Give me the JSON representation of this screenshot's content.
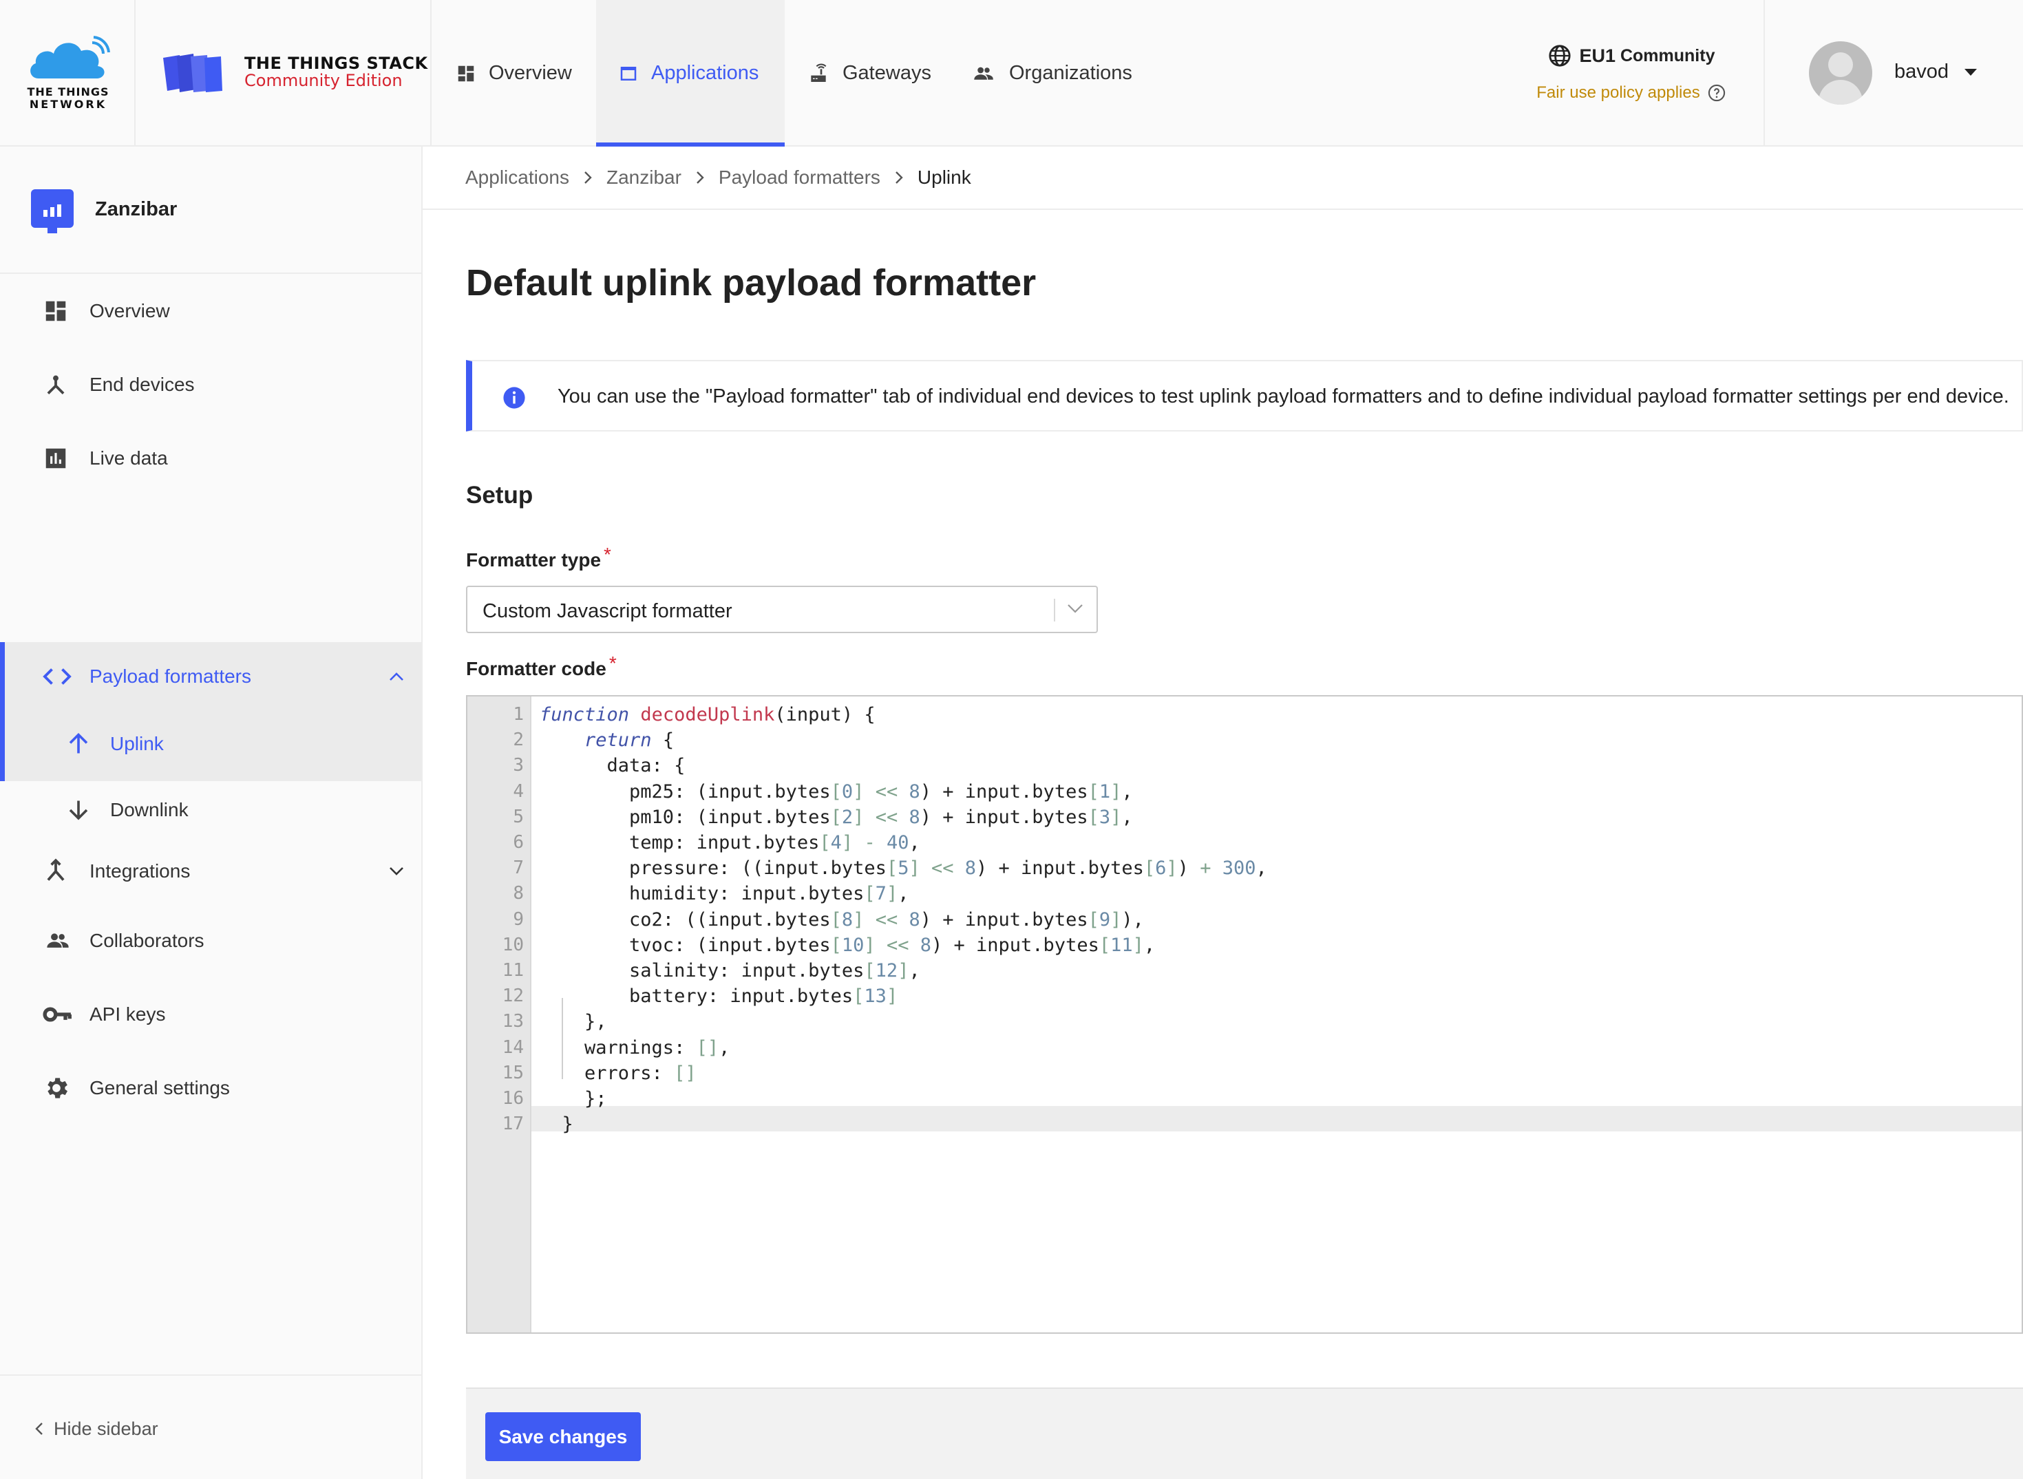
{
  "header": {
    "ttn_logo_line1": "THE THINGS",
    "ttn_logo_line2": "NETWORK",
    "stack_logo_line1": "THE THINGS STACK",
    "stack_logo_line2": "Community Edition",
    "nav": [
      {
        "label": "Overview",
        "icon": "dashboard-icon"
      },
      {
        "label": "Applications",
        "icon": "application-window-icon",
        "active": true
      },
      {
        "label": "Gateways",
        "icon": "router-icon"
      },
      {
        "label": "Organizations",
        "icon": "people-icon"
      }
    ],
    "cluster_label": "EU1",
    "cluster_sub": "Community",
    "fair_use": "Fair use policy applies",
    "username": "bavod"
  },
  "sidebar": {
    "app_name": "Zanzibar",
    "items": [
      {
        "label": "Overview",
        "icon": "dashboard-icon"
      },
      {
        "label": "End devices",
        "icon": "device-hub-icon"
      },
      {
        "label": "Live data",
        "icon": "bar-chart-icon"
      },
      {
        "label": "Payload formatters",
        "icon": "code-icon",
        "expanded": true
      },
      {
        "label": "Uplink",
        "icon": "arrow-up-icon",
        "active": true
      },
      {
        "label": "Downlink",
        "icon": "arrow-down-icon"
      },
      {
        "label": "Integrations",
        "icon": "merge-icon"
      },
      {
        "label": "Collaborators",
        "icon": "people-icon"
      },
      {
        "label": "API keys",
        "icon": "key-icon"
      },
      {
        "label": "General settings",
        "icon": "gear-icon"
      }
    ],
    "hide_label": "Hide sidebar"
  },
  "breadcrumb": [
    "Applications",
    "Zanzibar",
    "Payload formatters",
    "Uplink"
  ],
  "page": {
    "title": "Default uplink payload formatter",
    "notice": "You can use the \"Payload formatter\" tab of individual end devices to test uplink payload formatters and to define individual payload formatter settings per end device.",
    "setup_title": "Setup",
    "formatter_type_label": "Formatter type",
    "formatter_type_value": "Custom Javascript formatter",
    "formatter_code_label": "Formatter code",
    "required_mark": "*",
    "save_label": "Save changes"
  },
  "code": {
    "line_numbers": [
      "1",
      "2",
      "3",
      "4",
      "5",
      "6",
      "7",
      "8",
      "9",
      "10",
      "11",
      "12",
      "13",
      "14",
      "15",
      "16",
      "17"
    ],
    "lines": [
      "function decodeUplink(input) {",
      "    return {",
      "      data: {",
      "        pm25: (input.bytes[0] << 8) + input.bytes[1],",
      "        pm10: (input.bytes[2] << 8) + input.bytes[3],",
      "        temp: input.bytes[4] - 40,",
      "        pressure: ((input.bytes[5] << 8) + input.bytes[6]) + 300,",
      "        humidity: input.bytes[7],",
      "        co2: ((input.bytes[8] << 8) + input.bytes[9]),",
      "        tvoc: (input.bytes[10] << 8) + input.bytes[11],",
      "        salinity: input.bytes[12],",
      "        battery: input.bytes[13]",
      "    },",
      "    warnings: [],",
      "    errors: []",
      "    };",
      "  }"
    ],
    "active_line": 17
  },
  "colors": {
    "accent": "#3f5bf3",
    "required": "#d6232f",
    "fair_use": "#c08a0a",
    "keyword": "#4253a8",
    "function_name": "#c2384e"
  }
}
